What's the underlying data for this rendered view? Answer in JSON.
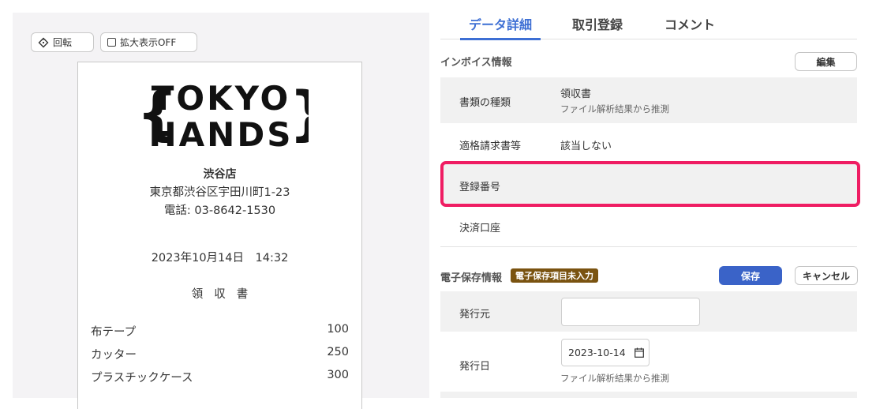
{
  "preview": {
    "rotate_label": "回転",
    "zoom_label": "拡大表示OFF",
    "receipt": {
      "logo_line1": "TOKYO",
      "logo_line2": "HANDS",
      "store_name": "渋谷店",
      "address": "東京都渋谷区宇田川町1-23",
      "phone": "電話: 03-8642-1530",
      "datetime": "2023年10月14日　14:32",
      "doc_title": "領収書",
      "items": [
        {
          "name": "布テープ",
          "price": "100"
        },
        {
          "name": "カッター",
          "price": "250"
        },
        {
          "name": "プラスチックケース",
          "price": "300"
        }
      ]
    }
  },
  "tabs": [
    {
      "label": "データ詳細",
      "active": true
    },
    {
      "label": "取引登録",
      "active": false
    },
    {
      "label": "コメント",
      "active": false
    }
  ],
  "invoice": {
    "title": "インボイス情報",
    "edit_label": "編集",
    "doc_type_label": "書類の種類",
    "doc_type_value": "領収書",
    "doc_type_note": "ファイル解析結果から推測",
    "qualified_label": "適格請求書等",
    "qualified_value": "該当しない",
    "reg_no_label": "登録番号",
    "account_label": "決済口座"
  },
  "estorage": {
    "title": "電子保存情報",
    "badge": "電子保存項目未入力",
    "save_label": "保存",
    "cancel_label": "キャンセル",
    "issuer_label": "発行元",
    "issuer_value": "",
    "issue_date_label": "発行日",
    "issue_date_value": "2023-10-14",
    "issue_date_note": "ファイル解析結果から推測"
  },
  "colors": {
    "accent": "#3d6fd4",
    "highlight": "#ef1d63",
    "badge": "#7a5310",
    "save": "#3a63c8"
  }
}
